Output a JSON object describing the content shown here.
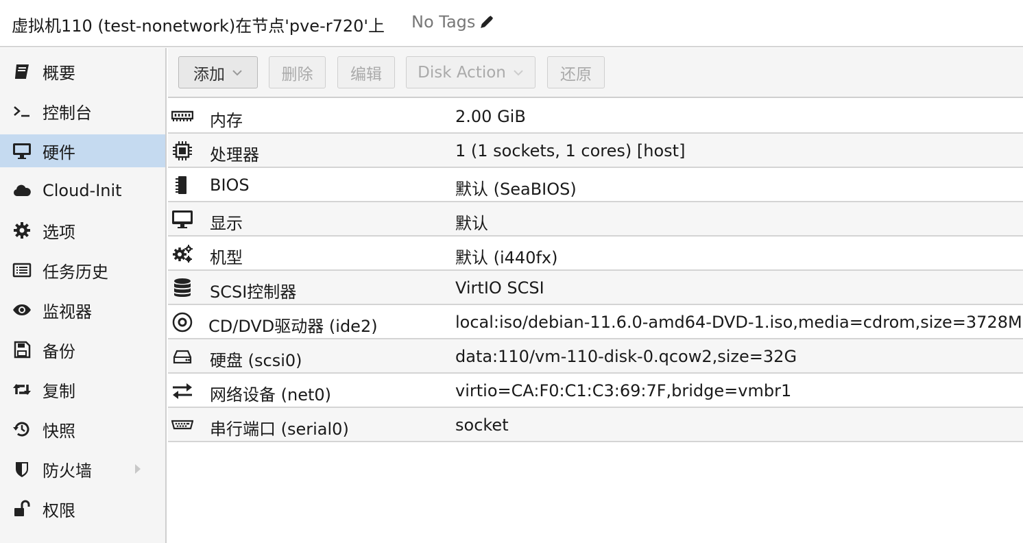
{
  "header": {
    "title": "虚拟机110 (test-nonetwork)在节点'pve-r720'上",
    "tags_label": "No Tags"
  },
  "sidebar": {
    "items": [
      {
        "label": "概要",
        "icon": "book-icon"
      },
      {
        "label": "控制台",
        "icon": "terminal-icon"
      },
      {
        "label": "硬件",
        "icon": "desktop-icon",
        "active": true
      },
      {
        "label": "Cloud-Init",
        "icon": "cloud-icon"
      },
      {
        "label": "选项",
        "icon": "gear-icon"
      },
      {
        "label": "任务历史",
        "icon": "list-icon"
      },
      {
        "label": "监视器",
        "icon": "eye-icon"
      },
      {
        "label": "备份",
        "icon": "floppy-icon"
      },
      {
        "label": "复制",
        "icon": "retweet-icon"
      },
      {
        "label": "快照",
        "icon": "history-icon"
      },
      {
        "label": "防火墙",
        "icon": "shield-icon"
      },
      {
        "label": "权限",
        "icon": "unlock-icon"
      }
    ]
  },
  "toolbar": {
    "add_label": "添加",
    "remove_label": "删除",
    "edit_label": "编辑",
    "disk_action_label": "Disk Action",
    "revert_label": "还原"
  },
  "hardware": {
    "rows": [
      {
        "name": "内存",
        "value": "2.00 GiB",
        "icon": "memory-icon"
      },
      {
        "name": "处理器",
        "value": "1 (1 sockets, 1 cores) [host]",
        "icon": "cpu-icon"
      },
      {
        "name": "BIOS",
        "value": "默认 (SeaBIOS)",
        "icon": "microchip-icon"
      },
      {
        "name": "显示",
        "value": "默认",
        "icon": "desktop-icon"
      },
      {
        "name": "机型",
        "value": "默认 (i440fx)",
        "icon": "cogs-icon"
      },
      {
        "name": "SCSI控制器",
        "value": "VirtIO SCSI",
        "icon": "database-icon"
      },
      {
        "name": "CD/DVD驱动器 (ide2)",
        "value": "local:iso/debian-11.6.0-amd64-DVD-1.iso,media=cdrom,size=3728M",
        "icon": "cdrom-icon"
      },
      {
        "name": "硬盘 (scsi0)",
        "value": "data:110/vm-110-disk-0.qcow2,size=32G",
        "icon": "hdd-icon"
      },
      {
        "name": "网络设备 (net0)",
        "value": "virtio=CA:F0:C1:C3:69:7F,bridge=vmbr1",
        "icon": "exchange-icon"
      },
      {
        "name": "串行端口 (serial0)",
        "value": "socket",
        "icon": "serial-port-icon"
      }
    ]
  },
  "colors": {
    "active_nav": "#c5daf0",
    "sidebar_bg": "#f5f5f5"
  }
}
